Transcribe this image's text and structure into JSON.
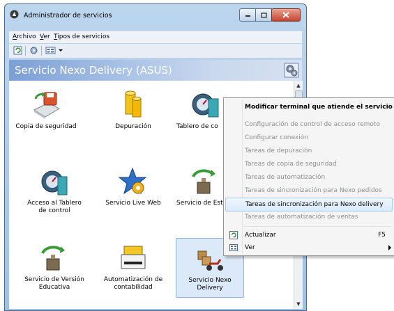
{
  "window": {
    "title": "Administrador de servicios",
    "controls": {
      "minimize": "minimize-icon",
      "maximize": "maximize-icon",
      "close": "close-icon"
    }
  },
  "menubar": {
    "items": [
      "Archivo",
      "Ver",
      "Tipos de servicios"
    ]
  },
  "toolbar": {
    "icons": [
      "refresh-icon",
      "settings-icon",
      "view-icon",
      "dropdown-arrow-icon"
    ]
  },
  "banner": {
    "title": "Servicio Nexo Delivery (ASUS)",
    "icon": "services-icon"
  },
  "items": [
    {
      "label": "Copia de seguridad",
      "icon": "backup-icon"
    },
    {
      "label": "Depuración",
      "icon": "database-icon"
    },
    {
      "label": "Tablero de co",
      "icon": "dashboard-icon"
    },
    {
      "label": "Acceso al Tablero de control",
      "icon": "dashboard-access-icon"
    },
    {
      "label": "Servicio Live Web",
      "icon": "live-web-icon"
    },
    {
      "label": "Servicio de Estad",
      "icon": "stats-service-icon"
    },
    {
      "label": "Servicio de Versión Educativa",
      "icon": "education-icon"
    },
    {
      "label": "Automatización de contabilidad",
      "icon": "accounting-icon"
    },
    {
      "label": "Servicio Nexo Delivery",
      "icon": "delivery-icon",
      "selected": true
    }
  ],
  "context_menu": {
    "items": [
      {
        "label": "Modificar terminal que atiende el servicio",
        "state": "bold"
      },
      {
        "label": "Configuración de control de acceso remoto",
        "state": "disabled"
      },
      {
        "label": "Configurar conexión",
        "state": "disabled"
      },
      {
        "label": "Tareas de depuración",
        "state": "disabled"
      },
      {
        "label": "Tareas de copia de seguridad",
        "state": "disabled"
      },
      {
        "label": "Tareas de automatización",
        "state": "disabled"
      },
      {
        "label": "Tareas de sincronización para Nexo pedidos",
        "state": "disabled"
      },
      {
        "label": "Tareas de sincronización para Nexo delivery",
        "state": "highlighted"
      },
      {
        "label": "Tareas de automatización de ventas",
        "state": "disabled"
      },
      {
        "label": "Actualizar",
        "shortcut": "F5",
        "icon": "refresh-icon"
      },
      {
        "label": "Ver",
        "icon": "view-icon",
        "submenu": true
      }
    ]
  },
  "colors": {
    "highlight": "#dcebfc",
    "banner": "#7b9fd4",
    "disabled_text": "#8d8d8d"
  }
}
